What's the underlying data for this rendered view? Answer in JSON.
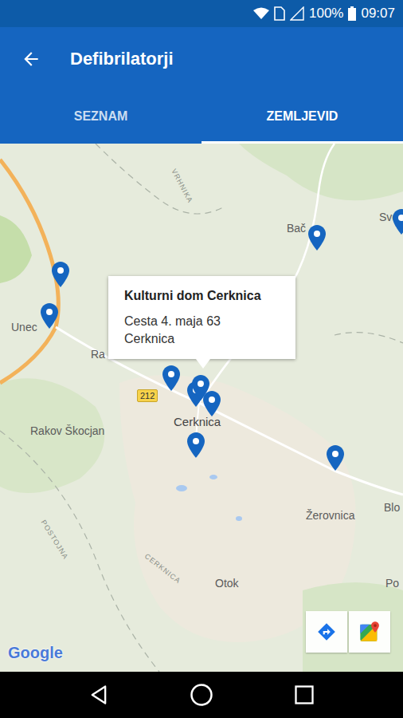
{
  "status_bar": {
    "battery": "100%",
    "time": "09:07"
  },
  "app_bar": {
    "title": "Defibrilatorji"
  },
  "tabs": [
    {
      "label": "SEZNAM",
      "selected": false
    },
    {
      "label": "ZEMLJEVID",
      "selected": true
    }
  ],
  "map": {
    "labels": [
      {
        "text": "Unec",
        "kind": "place"
      },
      {
        "text": "Ra",
        "kind": "place"
      },
      {
        "text": "Rakov Škocjan",
        "kind": "place"
      },
      {
        "text": "Cerknica",
        "kind": "town"
      },
      {
        "text": "Žerovnica",
        "kind": "place"
      },
      {
        "text": "Otok",
        "kind": "place"
      },
      {
        "text": "Blo",
        "kind": "place"
      },
      {
        "text": "Po",
        "kind": "place"
      },
      {
        "text": "Bač",
        "kind": "place"
      },
      {
        "text": "Sve",
        "kind": "place"
      },
      {
        "text": "212",
        "kind": "shield"
      },
      {
        "text": "VRHNIKA",
        "kind": "road"
      },
      {
        "text": "POSTOJNA",
        "kind": "road"
      },
      {
        "text": "CERKNICA",
        "kind": "road"
      }
    ],
    "markers": [
      {
        "selected": false
      },
      {
        "selected": false
      },
      {
        "selected": false
      },
      {
        "selected": false
      },
      {
        "selected": false
      },
      {
        "selected": true
      },
      {
        "selected": false
      },
      {
        "selected": false
      },
      {
        "selected": false
      },
      {
        "selected": false
      }
    ],
    "popup": {
      "title": "Kulturni dom Cerknica",
      "address": "Cesta 4. maja 63",
      "city": "Cerknica"
    },
    "attribution": "Google"
  }
}
